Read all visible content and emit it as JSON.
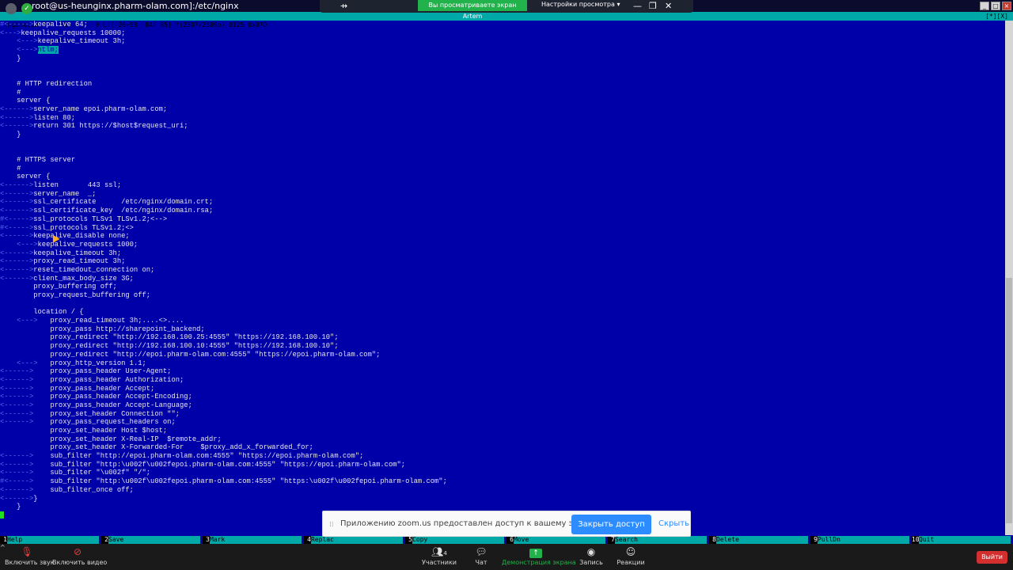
{
  "window": {
    "title": "root@us-heunginx.pharm-olam.com]:/etc/nginx"
  },
  "zoom_banner": {
    "share_label": "Вы просматриваете экран Artem",
    "view_options": "Настройки просмотра ▾"
  },
  "status": {
    "left": "nginx.conf    [B---]   0 L:[ 26+58  84/ 85] *(2507/2509b) 0125 0x07D",
    "right": "[*][X]"
  },
  "editor_lines": [
    {
      "tab": "#<----->",
      "code": "keepalive 64;"
    },
    {
      "tab": "<--->",
      "code": "keepalive_requests 10000;"
    },
    {
      "tab": "    <--->",
      "code": "keepalive_timeout 3h;"
    },
    {
      "tab": "    <--->",
      "code": "ntlm;",
      "highlight": true
    },
    {
      "tab": "    ",
      "code": "}"
    },
    {
      "tab": "",
      "code": ""
    },
    {
      "tab": "",
      "code": ""
    },
    {
      "tab": "    ",
      "code": "# HTTP redirection"
    },
    {
      "tab": "    ",
      "code": "#"
    },
    {
      "tab": "    ",
      "code": "server {"
    },
    {
      "tab": "<------>",
      "code": "server_name epoi.pharm-olam.com;"
    },
    {
      "tab": "<------>",
      "code": "listen 80;"
    },
    {
      "tab": "<------>",
      "code": "return 301 https://$host$request_uri;"
    },
    {
      "tab": "    ",
      "code": "}"
    },
    {
      "tab": "",
      "code": ""
    },
    {
      "tab": "",
      "code": ""
    },
    {
      "tab": "    ",
      "code": "# HTTPS server"
    },
    {
      "tab": "    ",
      "code": "#"
    },
    {
      "tab": "    ",
      "code": "server {"
    },
    {
      "tab": "<------>",
      "code": "listen       443 ssl;"
    },
    {
      "tab": "<------>",
      "code": "server_name  _;"
    },
    {
      "tab": "<------>",
      "code": "ssl_certificate      /etc/nginx/domain.crt;"
    },
    {
      "tab": "<------>",
      "code": "ssl_certificate_key  /etc/nginx/domain.rsa;"
    },
    {
      "tab": "#<----->",
      "code": "ssl_protocols TLSv1 TLSv1.2;<-->"
    },
    {
      "tab": "#<----->",
      "code": "ssl_protocols TLSv1.2;<>"
    },
    {
      "tab": "<------>",
      "code": "keepalive_disable none;"
    },
    {
      "tab": "    <--->",
      "code": "keepalive_requests 1000;"
    },
    {
      "tab": "<------>",
      "code": "keepalive_timeout 3h;"
    },
    {
      "tab": "<------>",
      "code": "proxy_read_timeout 3h;"
    },
    {
      "tab": "<------>",
      "code": "reset_timedout_connection on;"
    },
    {
      "tab": "<------>",
      "code": "client_max_body_size 3G;"
    },
    {
      "tab": "        ",
      "code": "proxy_buffering off;"
    },
    {
      "tab": "        ",
      "code": "proxy_request_buffering off;"
    },
    {
      "tab": "",
      "code": ""
    },
    {
      "tab": "        ",
      "code": "location / {"
    },
    {
      "tab": "    <--->   ",
      "code": "proxy_read_timeout 3h;....<>...."
    },
    {
      "tab": "            ",
      "code": "proxy_pass http://sharepoint_backend;"
    },
    {
      "tab": "            ",
      "code": "proxy_redirect \"http://192.168.100.25:4555\" \"https://192.168.100.10\";"
    },
    {
      "tab": "            ",
      "code": "proxy_redirect \"http://192.168.100.10:4555\" \"https://192.168.100.10\";"
    },
    {
      "tab": "            ",
      "code": "proxy_redirect \"http://epoi.pharm-olam.com:4555\" \"https://epoi.pharm-olam.com\";"
    },
    {
      "tab": "    <--->   ",
      "code": "proxy_http_version 1.1;"
    },
    {
      "tab": "<------>    ",
      "code": "proxy_pass_header User-Agent;"
    },
    {
      "tab": "<------>    ",
      "code": "proxy_pass_header Authorization;"
    },
    {
      "tab": "<------>    ",
      "code": "proxy_pass_header Accept;"
    },
    {
      "tab": "<------>    ",
      "code": "proxy_pass_header Accept-Encoding;"
    },
    {
      "tab": "<------>    ",
      "code": "proxy_pass_header Accept-Language;"
    },
    {
      "tab": "<------>    ",
      "code": "proxy_set_header Connection \"\";"
    },
    {
      "tab": "<------>    ",
      "code": "proxy_pass_request_headers on;"
    },
    {
      "tab": "            ",
      "code": "proxy_set_header Host $host;"
    },
    {
      "tab": "            ",
      "code": "proxy_set_header X-Real-IP  $remote_addr;"
    },
    {
      "tab": "            ",
      "code": "proxy_set_header X-Forwarded-For    $proxy_add_x_forwarded_for;"
    },
    {
      "tab": "<------>    ",
      "code": "sub_filter \"http://epoi.pharm-olam.com:4555\" \"https://epoi.pharm-olam.com\";"
    },
    {
      "tab": "<------>    ",
      "code": "sub_filter \"http:\\u002f\\u002fepoi.pharm-olam.com:4555\" \"https://epoi.pharm-olam.com\";"
    },
    {
      "tab": "<------>    ",
      "code": "sub_filter \"\\u002f\" \"/\";"
    },
    {
      "tab": "#<----->    ",
      "code": "sub_filter \"http:\\u002f\\u002fepoi.pharm-olam.com:4555\" \"https:\\u002f\\u002fepoi.pharm-olam.com\";"
    },
    {
      "tab": "<------>    ",
      "code": "sub_filter_once off;"
    },
    {
      "tab": "<------>",
      "code": "}"
    },
    {
      "tab": "    ",
      "code": "}"
    },
    {
      "tab": "",
      "code": ""
    }
  ],
  "notice": {
    "message": "Приложению zoom.us предоставлен доступ к вашему экрану.",
    "stop_button": "Закрыть доступ",
    "hide_link": "Скрыть"
  },
  "fkeys": [
    {
      "num": "1",
      "label": "Help"
    },
    {
      "num": "2",
      "label": "Save"
    },
    {
      "num": "3",
      "label": "Mark"
    },
    {
      "num": "4",
      "label": "Replac"
    },
    {
      "num": "5",
      "label": "Copy"
    },
    {
      "num": "6",
      "label": "Move"
    },
    {
      "num": "7",
      "label": "Search"
    },
    {
      "num": "8",
      "label": "Delete"
    },
    {
      "num": "9",
      "label": "PullDn"
    },
    {
      "num": "10",
      "label": "Quit"
    }
  ],
  "toolbar": {
    "mute": "Включить звук",
    "video": "Включить видео",
    "participants": "Участники",
    "participants_count": "4",
    "chat": "Чат",
    "share": "Демонстрация экрана",
    "record": "Запись",
    "reactions": "Реакции",
    "end": "Выйти"
  }
}
